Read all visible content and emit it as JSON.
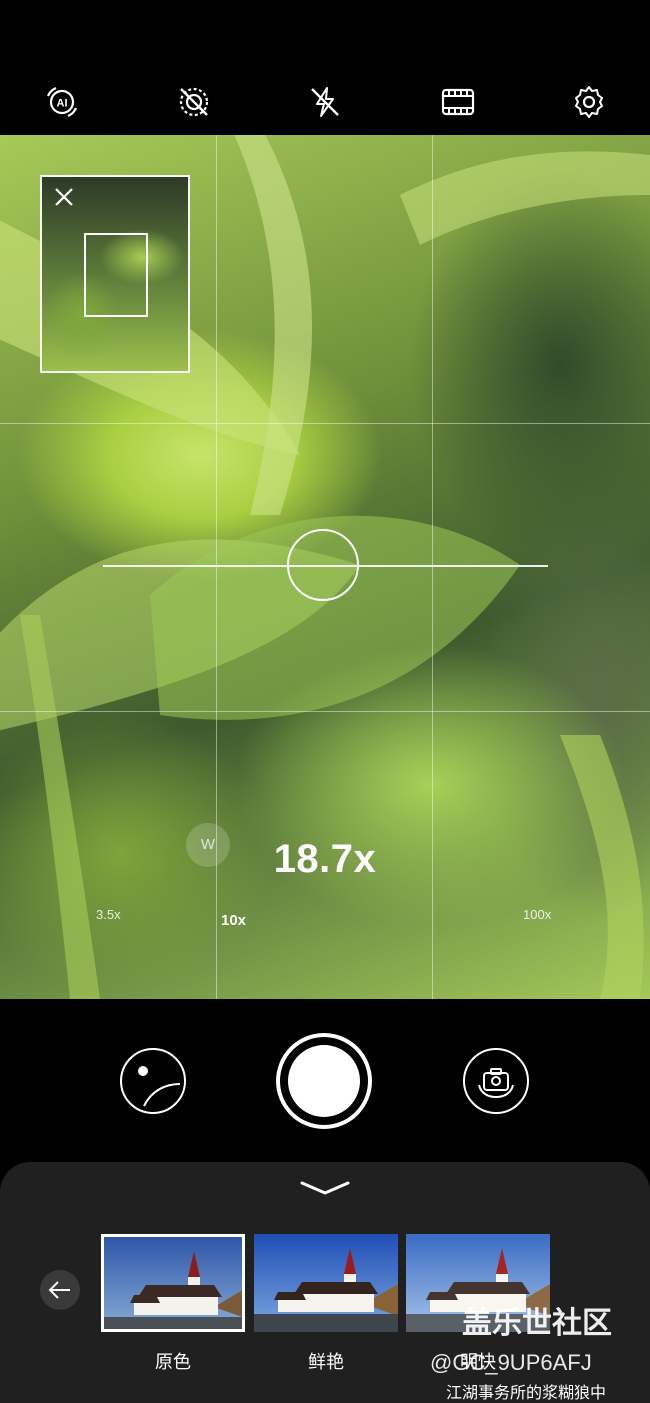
{
  "topbar": {
    "icons": [
      "ai-icon",
      "no-motion-icon",
      "flash-off-icon",
      "film-icon",
      "settings-icon"
    ]
  },
  "viewfinder": {
    "zoom_value": "18.7x",
    "wide_badge": "W",
    "zoom_scale": {
      "labels": [
        "3.5x",
        "10x",
        "100x"
      ],
      "current_zoom": 18.7,
      "marker_color": "#e53935"
    }
  },
  "controls": {
    "icons": [
      "gallery-icon",
      "shutter-icon",
      "switch-camera-icon"
    ]
  },
  "filters": {
    "items": [
      {
        "label": "原色",
        "selected": true
      },
      {
        "label": "鲜艳",
        "selected": false
      },
      {
        "label": "明快",
        "selected": false
      }
    ]
  },
  "watermark": {
    "line1": "盖乐世社区",
    "line2": "@GC_9UP6AFJ",
    "line3": "江湖事务所的浆糊狼中"
  }
}
